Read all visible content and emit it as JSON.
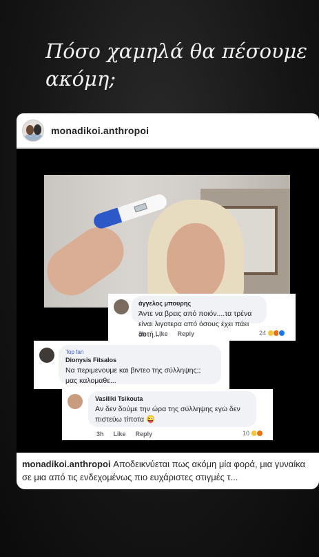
{
  "story": {
    "headline": "Πόσο χαμηλά θα πέσουμε ακόμη;"
  },
  "post": {
    "username": "monadikoi.anthropoi",
    "caption_user": "monadikoi.anthropoi",
    "caption_text": "Αποδεικνύεται πως ακόμη μία φορά, μια γυναίκα  σε μια από τις ενδεχομένως πιο ευχάριστες στιγμές τ..."
  },
  "comments": [
    {
      "name": "άγγελος μπουρης",
      "text": "Άντε να βρεις από ποιόν....τα τρένα είναι λιγοτερα από όσους έχει πάει αυτή....",
      "time": "3h",
      "like": "Like",
      "reply": "Reply",
      "reaction_count": "24"
    },
    {
      "badge": "Top fan",
      "name": "Dionysis Fitsalos",
      "text": "Να περιμενουμε και βιντεο της σύλληψης;; μας καλομαθε..."
    },
    {
      "name": "Vasiliki Tsikouta",
      "text": "Αν δεν δούμε την ώρα της σύλληψης εγώ δεν πιστεύω τίποτα 😜",
      "time": "3h",
      "like": "Like",
      "reply": "Reply",
      "reaction_count": "10"
    }
  ]
}
